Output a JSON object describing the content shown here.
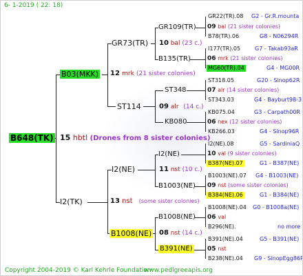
{
  "header": {
    "date": "6-  1-2019 ( 22: 18)"
  },
  "footer": {
    "copyright": "Copyright 2004-2019 © Karl Kehrle Foundation",
    "site": "www.pedigreeapis.org"
  },
  "colors": {
    "highlight_green": "#22dd22",
    "highlight_yellow": "#ffff22",
    "link_blue": "#2222dd",
    "generation_red": "#bb1111",
    "note_purple": "#9933cc"
  },
  "tree": {
    "root": {
      "name": "B648(TK)"
    },
    "root_gen": {
      "num": "15",
      "code": "hbtl",
      "note": "(Drones from 8 sister colonies)"
    },
    "n_b03": {
      "name": "B03(MKK)"
    },
    "g_b03": {
      "num": "12",
      "code": "mrk",
      "note": "(21 sister colonies)"
    },
    "n_i2tk": {
      "name": "I2(TK)"
    },
    "g_i2tk": {
      "num": "13",
      "code": "nst",
      "note": "(some sister colonies)"
    },
    "n_gr73": {
      "name": "GR73(TR)"
    },
    "n_st114": {
      "name": "ST114"
    },
    "g_st114": {
      "num": "09",
      "code": "alr",
      "note": "(14 c.)"
    },
    "n_i2ne": {
      "name": "I2(NE)"
    },
    "g_i2ne": {
      "num": "11",
      "code": "nst",
      "note": "(10 c.)"
    },
    "n_b1008": {
      "name": "B1008(NE)"
    },
    "g_b1008": {
      "num": "08",
      "code": "nst",
      "note": "(14 c.)"
    },
    "n_gr109": {
      "name": "GR109(TR)"
    },
    "g_gr73": {
      "num": "10",
      "code": "bal",
      "note": "(23 c.)"
    },
    "n_b135": {
      "name": "B135(TR)"
    },
    "n_st348": {
      "name": "ST348"
    },
    "g_st348": {
      "num": "07",
      "code": "alr",
      "note": "(14 sister colonies)"
    },
    "n_kb080": {
      "name": "KB080"
    },
    "g_kb080": {
      "num": "06",
      "code": "nex",
      "note": "(12 sister colonies)"
    },
    "n_i2ne2": {
      "name": "I2(NE)"
    },
    "g_i2ne2": {
      "num": "10",
      "code": "val",
      "note": "(9 sister colonies)"
    },
    "n_b1003": {
      "name": "B1003(NE)"
    },
    "g_b1003": {
      "num": "09",
      "code": "nst",
      "note": "(some sister colonies)"
    },
    "n_b1008b": {
      "name": "B1008(NE)"
    },
    "g_b1008b": {
      "num": "06",
      "code": "val"
    },
    "n_b391": {
      "name": "B391(NE)"
    },
    "g_b391": {
      "num": "05",
      "code": "nst"
    },
    "g_gr109": {
      "num": "09",
      "code": "bal",
      "note": "(21 sister colonies)"
    },
    "g_b135": {
      "num": "06",
      "code": "mrk",
      "note": "(21 sister colonies)"
    },
    "leaves": [
      {
        "name": "GR22(TR).08",
        "link": "G2 - Gr.R.mounta"
      },
      {
        "name": "B78(TR).06",
        "link": "G8 - N06294R"
      },
      {
        "name": "I177(TR).05",
        "link": "G7 - Takab93aR"
      },
      {
        "name": "MG60(TR).04",
        "link": "G4 - MG00R"
      },
      {
        "name": "ST318.05",
        "link": "G20 - Sinop62R"
      },
      {
        "name": "ST343.03",
        "link": "G4 - Bayburt98-3"
      },
      {
        "name": "KB075.04",
        "link": "G3 - Carpath00R"
      },
      {
        "name": "KB266.03",
        "link": "G4 - Sinop96R"
      },
      {
        "name": "I2(NE).08",
        "link": "G5 - SardiniaQ"
      },
      {
        "name": "B387(NE).07",
        "link": "G1 - B387(NE)"
      },
      {
        "name": "B1003(NE).07",
        "link": "G4 - B1003(NE)"
      },
      {
        "name": "B384(NE).06",
        "link": "G1 - B384(NE)"
      },
      {
        "name": "B1008(NE).04",
        "link": "G0 - B1008a(NE)"
      },
      {
        "name": "B296(NE).",
        "link": "no more"
      },
      {
        "name": "B391(NE).04",
        "link": "G5 - B391(NE)"
      },
      {
        "name": "B238(NE).04",
        "link": "G9 - SinopEgg86R"
      }
    ]
  }
}
